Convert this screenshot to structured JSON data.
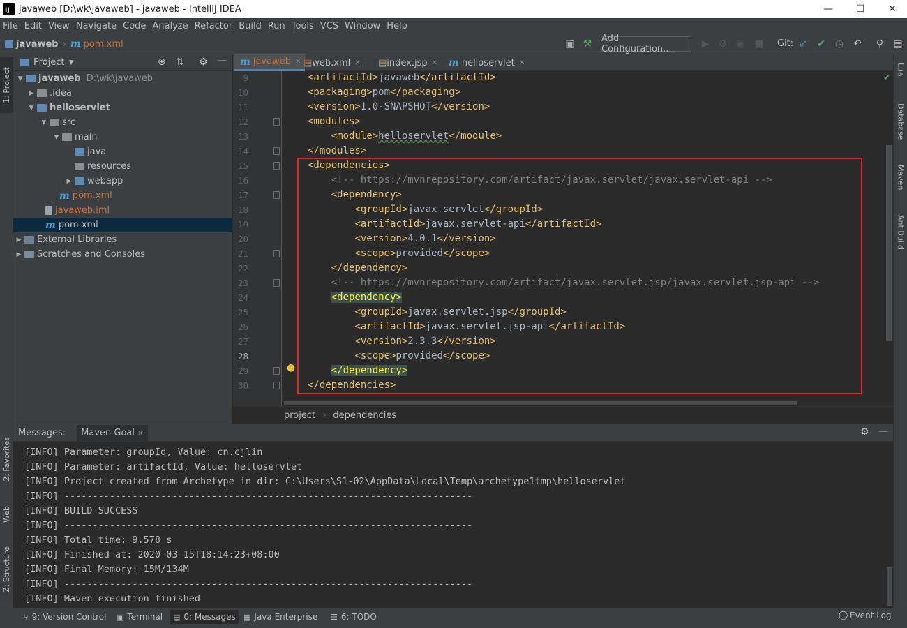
{
  "window": {
    "title": "javaweb [D:\\wk\\javaweb] - javaweb - IntelliJ IDEA",
    "logo": "IJ"
  },
  "menu": [
    "File",
    "Edit",
    "View",
    "Navigate",
    "Code",
    "Analyze",
    "Refactor",
    "Build",
    "Run",
    "Tools",
    "VCS",
    "Window",
    "Help"
  ],
  "navbar": {
    "project": "javaweb",
    "file": "pom.xml",
    "add_configuration": "Add Configuration...",
    "git_label": "Git:"
  },
  "left_stripe": {
    "project_tab": "1: Project",
    "favorites_tab": "2: Favorites",
    "web_tab": "Web",
    "structure_tab": "Z: Structure"
  },
  "right_stripe": {
    "lua_tab": "Lua",
    "database_tab": "Database",
    "maven_tab": "Maven",
    "ant_tab": "Ant Build"
  },
  "project_panel": {
    "title": "Project",
    "tree": [
      {
        "label": "javaweb",
        "extra": "D:\\wk\\javaweb",
        "bold": true
      },
      {
        "label": ".idea"
      },
      {
        "label": "helloservlet",
        "bold": true
      },
      {
        "label": "src"
      },
      {
        "label": "main"
      },
      {
        "label": "java"
      },
      {
        "label": "resources"
      },
      {
        "label": "webapp"
      },
      {
        "label": "pom.xml"
      },
      {
        "label": "javaweb.iml"
      },
      {
        "label": "pom.xml"
      },
      {
        "label": "External Libraries"
      },
      {
        "label": "Scratches and Consoles"
      }
    ]
  },
  "editor": {
    "tabs": [
      {
        "label": "javaweb",
        "active": true
      },
      {
        "label": "web.xml"
      },
      {
        "label": "index.jsp"
      },
      {
        "label": "helloservlet"
      }
    ],
    "line_numbers": [
      "9",
      "10",
      "11",
      "12",
      "13",
      "14",
      "15",
      "16",
      "17",
      "18",
      "19",
      "20",
      "21",
      "22",
      "23",
      "24",
      "25",
      "26",
      "27",
      "28",
      "29",
      "30"
    ],
    "current_line": "28",
    "lines": [
      [
        "",
        "<artifactId>",
        "javaweb",
        "</artifactId>"
      ],
      [
        "",
        "<packaging>",
        "pom",
        "</packaging>"
      ],
      [
        "",
        "<version>",
        "1.0-SNAPSHOT",
        "</version>"
      ],
      [
        "",
        "<modules>",
        "",
        ""
      ],
      [
        "    ",
        "<module>",
        "helloservlet",
        "</module>"
      ],
      [
        "",
        "</modules>",
        "",
        ""
      ],
      [
        "",
        "<dependencies>",
        "",
        ""
      ],
      [
        "    ",
        "",
        "<!-- https://mvnrepository.com/artifact/javax.servlet/javax.servlet-api -->",
        ""
      ],
      [
        "    ",
        "<dependency>",
        "",
        ""
      ],
      [
        "        ",
        "<groupId>",
        "javax.servlet",
        "</groupId>"
      ],
      [
        "        ",
        "<artifactId>",
        "javax.servlet-api",
        "</artifactId>"
      ],
      [
        "        ",
        "<version>",
        "4.0.1",
        "</version>"
      ],
      [
        "        ",
        "<scope>",
        "provided",
        "</scope>"
      ],
      [
        "    ",
        "</dependency>",
        "",
        ""
      ],
      [
        "    ",
        "",
        "<!-- https://mvnrepository.com/artifact/javax.servlet.jsp/javax.servlet.jsp-api -->",
        ""
      ],
      [
        "    ",
        "<dependency>",
        "",
        ""
      ],
      [
        "        ",
        "<groupId>",
        "javax.servlet.jsp",
        "</groupId>"
      ],
      [
        "        ",
        "<artifactId>",
        "javax.servlet.jsp-api",
        "</artifactId>"
      ],
      [
        "        ",
        "<version>",
        "2.3.3",
        "</version>"
      ],
      [
        "        ",
        "<scope>",
        "provided",
        "</scope>"
      ],
      [
        "    ",
        "</dependency>",
        "",
        ""
      ],
      [
        "",
        "</dependencies>",
        "",
        ""
      ]
    ],
    "breadcrumb": [
      "project",
      "dependencies"
    ]
  },
  "messages": {
    "title": "Messages:",
    "tab": "Maven Goal",
    "lines": [
      "[INFO] Parameter: groupId, Value: cn.cjlin",
      "[INFO] Parameter: artifactId, Value: helloservlet",
      "[INFO] Project created from Archetype in dir: C:\\Users\\S1-02\\AppData\\Local\\Temp\\archetype1tmp\\helloservlet",
      "[INFO] ------------------------------------------------------------------------",
      "[INFO] BUILD SUCCESS",
      "[INFO] ------------------------------------------------------------------------",
      "[INFO] Total time: 9.578 s",
      "[INFO] Finished at: 2020-03-15T18:14:23+08:00",
      "[INFO] Final Memory: 15M/134M",
      "[INFO] ------------------------------------------------------------------------",
      "[INFO] Maven execution finished"
    ]
  },
  "bottom_tabs": [
    {
      "label": "9: Version Control"
    },
    {
      "label": "Terminal"
    },
    {
      "label": "0: Messages",
      "active": true
    },
    {
      "label": "Java Enterprise"
    },
    {
      "label": "6: TODO"
    }
  ],
  "event_log": "Event Log",
  "colors": {
    "tag": "#e8bf6a",
    "comment": "#808080",
    "text": "#a9b7c6",
    "highlight_box": "#e32727",
    "maven_icon": "#4d9ed1"
  }
}
